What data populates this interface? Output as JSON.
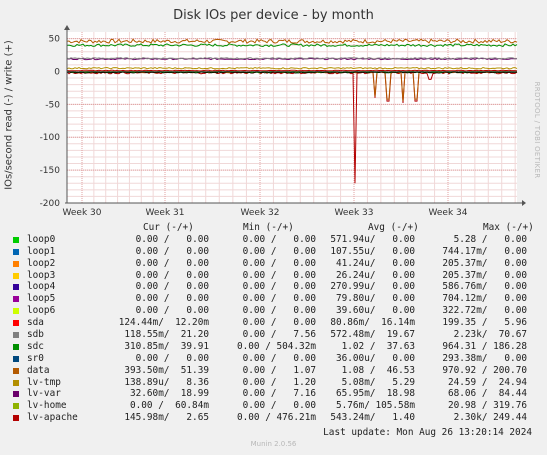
{
  "chart_data": {
    "type": "line",
    "title": "Disk IOs per device - by month",
    "ylabel": "IOs/second read (-) / write (+)",
    "ylim": [
      -200,
      60
    ],
    "yticks": [
      50,
      0,
      -50,
      -100,
      -150,
      -200
    ],
    "xticks": [
      "Week 30",
      "Week 31",
      "Week 32",
      "Week 33",
      "Week 34"
    ],
    "grid": true,
    "legend_position": "bottom",
    "series": [
      {
        "name": "loop0",
        "color": "#00cc00",
        "cur": "0.00 /   0.00",
        "min": "0.00 /   0.00",
        "avg": "571.94u/   0.00",
        "max": "5.28 /   0.00"
      },
      {
        "name": "loop1",
        "color": "#0066b3",
        "cur": "0.00 /   0.00",
        "min": "0.00 /   0.00",
        "avg": "107.55u/   0.00",
        "max": "744.17m/   0.00"
      },
      {
        "name": "loop2",
        "color": "#ff8000",
        "cur": "0.00 /   0.00",
        "min": "0.00 /   0.00",
        "avg": "41.24u/   0.00",
        "max": "205.37m/   0.00"
      },
      {
        "name": "loop3",
        "color": "#ffcc00",
        "cur": "0.00 /   0.00",
        "min": "0.00 /   0.00",
        "avg": "26.24u/   0.00",
        "max": "205.37m/   0.00"
      },
      {
        "name": "loop4",
        "color": "#330099",
        "cur": "0.00 /   0.00",
        "min": "0.00 /   0.00",
        "avg": "270.99u/   0.00",
        "max": "586.76m/   0.00"
      },
      {
        "name": "loop5",
        "color": "#990099",
        "cur": "0.00 /   0.00",
        "min": "0.00 /   0.00",
        "avg": "79.80u/   0.00",
        "max": "704.12m/   0.00"
      },
      {
        "name": "loop6",
        "color": "#ccff00",
        "cur": "0.00 /   0.00",
        "min": "0.00 /   0.00",
        "avg": "39.60u/   0.00",
        "max": "322.72m/   0.00"
      },
      {
        "name": "sda",
        "color": "#ff0000",
        "cur": "124.44m/  12.20m",
        "min": "0.00 /   0.00",
        "avg": "80.86m/  16.14m",
        "max": "199.35 /   5.96"
      },
      {
        "name": "sdb",
        "color": "#808080",
        "cur": "118.55m/  21.20",
        "min": "0.00 /   7.56",
        "avg": "572.48m/  19.67",
        "max": "2.23k/  70.67"
      },
      {
        "name": "sdc",
        "color": "#008f00",
        "cur": "310.85m/  39.91",
        "min": "0.00 / 504.32m",
        "avg": "1.02 /  37.63",
        "max": "964.31 / 186.28"
      },
      {
        "name": "sr0",
        "color": "#00487d",
        "cur": "0.00 /   0.00",
        "min": "0.00 /   0.00",
        "avg": "36.00u/   0.00",
        "max": "293.38m/   0.00"
      },
      {
        "name": "data",
        "color": "#b35a00",
        "cur": "393.50m/  51.39",
        "min": "0.00 /   1.07",
        "avg": "1.08 /  46.53",
        "max": "970.92 / 200.70"
      },
      {
        "name": "lv-tmp",
        "color": "#b38f00",
        "cur": "138.89u/   8.36",
        "min": "0.00 /   1.20",
        "avg": "5.08m/   5.29",
        "max": "24.59 /  24.94"
      },
      {
        "name": "lv-var",
        "color": "#6b006b",
        "cur": "32.60m/  18.99",
        "min": "0.00 /   7.16",
        "avg": "65.95m/  18.98",
        "max": "68.06 /  84.44"
      },
      {
        "name": "lv-home",
        "color": "#8fb300",
        "cur": "0.00 /  60.84m",
        "min": "0.00 /   0.00",
        "avg": "5.76m/ 105.58m",
        "max": "20.98 / 319.76"
      },
      {
        "name": "lv-apache",
        "color": "#b30000",
        "cur": "145.98m/   2.65",
        "min": "0.00 / 476.21m",
        "avg": "543.24m/   1.40",
        "max": "2.30k/ 249.44"
      }
    ]
  },
  "legend_headers": {
    "cur": "Cur (-/+)",
    "min": "Min (-/+)",
    "avg": "Avg (-/+)",
    "max": "Max (-/+)"
  },
  "footer": "Last update: Mon Aug 26 13:20:14 2024",
  "side_label": "RRDTOOL / TOBI OETIKER",
  "munin": "Munin 2.0.56"
}
